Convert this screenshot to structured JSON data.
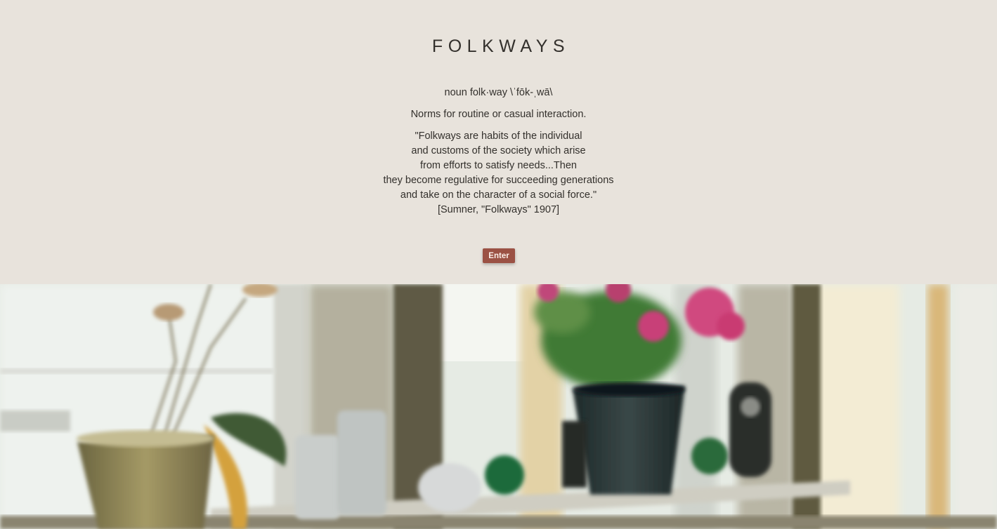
{
  "header": {
    "title": "FOLKWAYS"
  },
  "definition": {
    "pronunciation": "noun folk·way \\ˈfōk-ˌwā\\",
    "meaning": "Norms for routine or casual interaction.",
    "quote_lines": [
      "\"Folkways are habits of the individual",
      "and customs of the society which arise",
      "from efforts to satisfy needs...Then",
      "they become regulative for succeeding generations",
      "and take on the character of a social force.\"",
      "[Sumner, \"Folkways\" 1907]"
    ]
  },
  "enter_button": {
    "label": "Enter"
  },
  "colors": {
    "background": "#e8e3dc",
    "button": "#9b5144",
    "text": "#33302c"
  },
  "hero_image": {
    "subject": "potted-plants-on-windowsill-photo"
  }
}
